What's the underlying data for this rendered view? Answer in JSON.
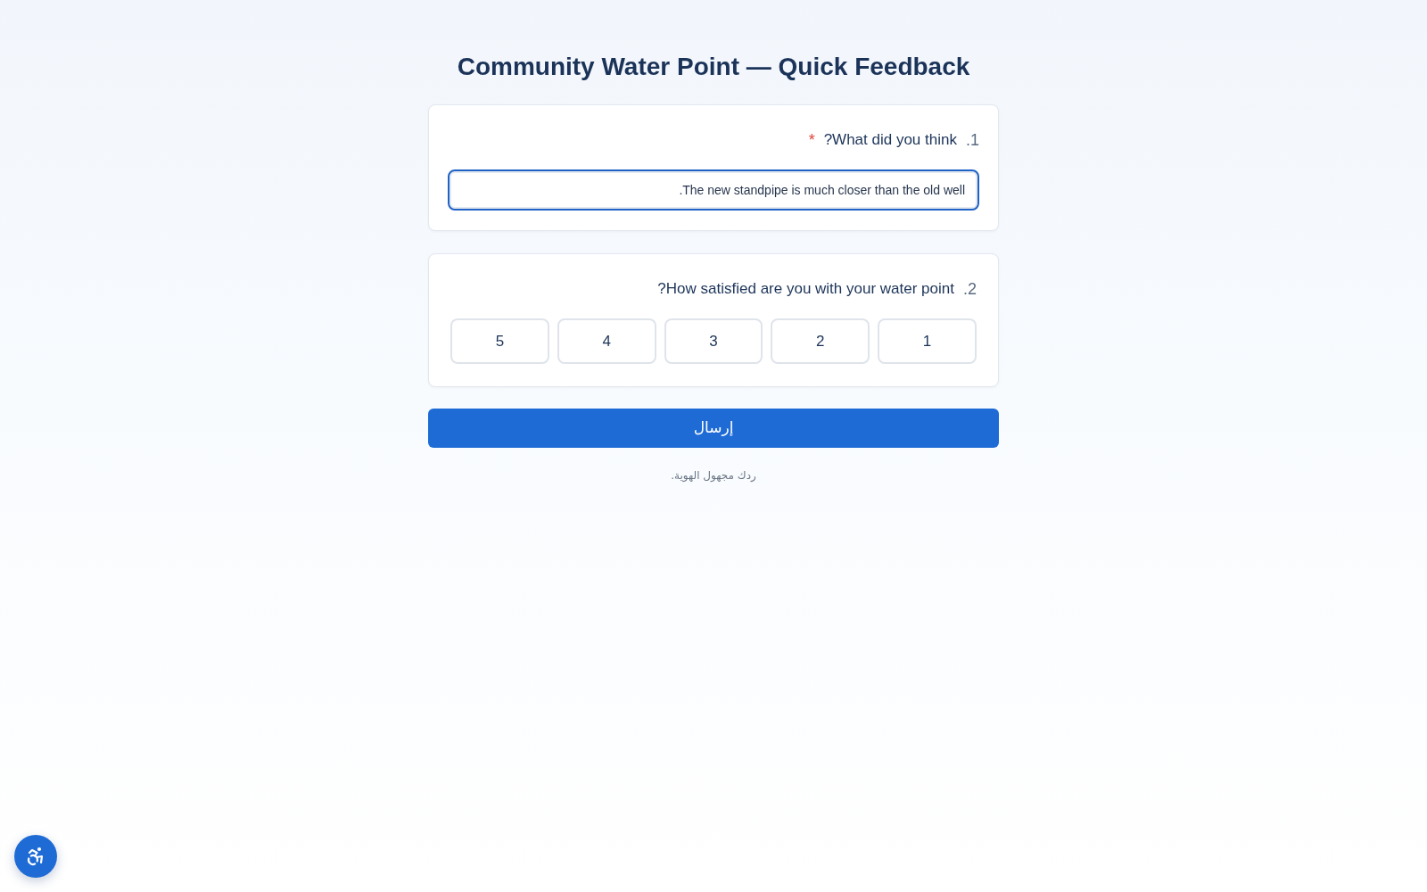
{
  "page": {
    "title": "Community Water Point — Quick Feedback"
  },
  "questions": [
    {
      "kind": "text",
      "number": "1.",
      "label": "What did you think?",
      "required_mark": "*",
      "value": "The new standpipe is much closer than the old well.",
      "focused": true
    },
    {
      "kind": "rating",
      "number": "2.",
      "label": "How satisfied are you with your water point?",
      "options": [
        {
          "label": "1",
          "selected": false
        },
        {
          "label": "2",
          "selected": false
        },
        {
          "label": "3",
          "selected": false
        },
        {
          "label": "4",
          "selected": false
        },
        {
          "label": "5",
          "selected": false
        }
      ]
    }
  ],
  "submit_button": {
    "label": "إرسال"
  },
  "footer_note": "ردك مجهول الهوية."
}
